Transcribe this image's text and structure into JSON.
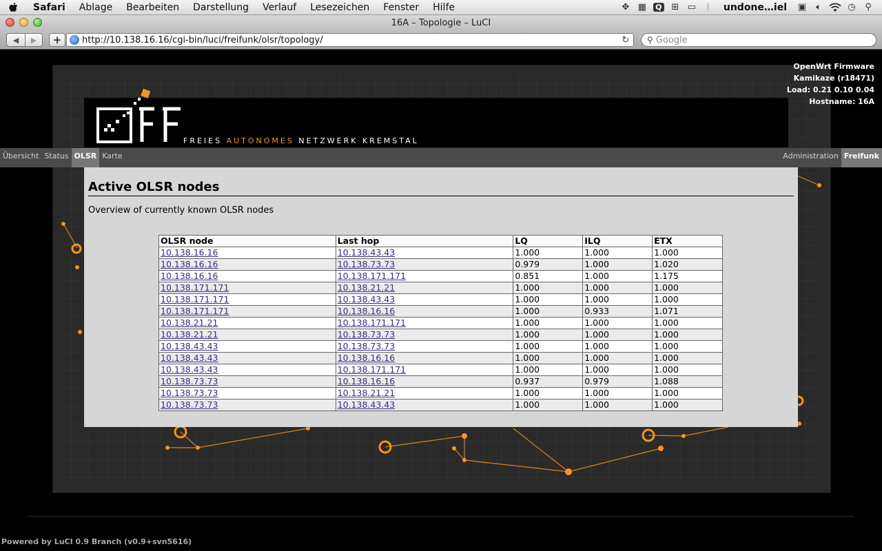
{
  "menubar": {
    "app": "Safari",
    "items": [
      "Ablage",
      "Bearbeiten",
      "Darstellung",
      "Verlauf",
      "Lesezeichen",
      "Fenster",
      "Hilfe"
    ],
    "user": "undone…iel"
  },
  "window": {
    "title": "16A – Topologie – LuCI"
  },
  "toolbar": {
    "url": "http://10.138.16.16/cgi-bin/luci/freifunk/olsr/topology/",
    "search_placeholder": "Google"
  },
  "header": {
    "tagline_1": "FREIES ",
    "tagline_2": "AUTONOMES",
    "tagline_3": " NETZWERK KREMSTAL",
    "sysinfo": [
      "OpenWrt Firmware",
      "Kamikaze (r18471)",
      "Load: 0.21 0.10 0.04",
      "Hostname: 16A"
    ]
  },
  "nav": {
    "left": [
      "Übersicht",
      "Status",
      "OLSR",
      "Karte"
    ],
    "right": [
      "Administration",
      "Freifunk"
    ]
  },
  "main": {
    "title": "Active OLSR nodes",
    "description": "Overview of currently known OLSR nodes",
    "columns": [
      "OLSR node",
      "Last hop",
      "LQ",
      "ILQ",
      "ETX"
    ],
    "rows": [
      [
        "10.138.16.16",
        "10.138.43.43",
        "1.000",
        "1.000",
        "1.000"
      ],
      [
        "10.138.16.16",
        "10.138.73.73",
        "0.979",
        "1.000",
        "1.020"
      ],
      [
        "10.138.16.16",
        "10.138.171.171",
        "0.851",
        "1.000",
        "1.175"
      ],
      [
        "10.138.171.171",
        "10.138.21.21",
        "1.000",
        "1.000",
        "1.000"
      ],
      [
        "10.138.171.171",
        "10.138.43.43",
        "1.000",
        "1.000",
        "1.000"
      ],
      [
        "10.138.171.171",
        "10.138.16.16",
        "1.000",
        "0.933",
        "1.071"
      ],
      [
        "10.138.21.21",
        "10.138.171.171",
        "1.000",
        "1.000",
        "1.000"
      ],
      [
        "10.138.21.21",
        "10.138.73.73",
        "1.000",
        "1.000",
        "1.000"
      ],
      [
        "10.138.43.43",
        "10.138.73.73",
        "1.000",
        "1.000",
        "1.000"
      ],
      [
        "10.138.43.43",
        "10.138.16.16",
        "1.000",
        "1.000",
        "1.000"
      ],
      [
        "10.138.43.43",
        "10.138.171.171",
        "1.000",
        "1.000",
        "1.000"
      ],
      [
        "10.138.73.73",
        "10.138.16.16",
        "0.937",
        "0.979",
        "1.088"
      ],
      [
        "10.138.73.73",
        "10.138.21.21",
        "1.000",
        "1.000",
        "1.000"
      ],
      [
        "10.138.73.73",
        "10.138.43.43",
        "1.000",
        "1.000",
        "1.000"
      ]
    ]
  },
  "footer": {
    "text": "Powered by LuCI 0.9 Branch (v0.9+svn5616)"
  },
  "colors": {
    "accent": "#f7931e",
    "link": "#3b2a8a",
    "nav_bg": "#4a4a4a",
    "content_bg": "#d6d6d6"
  }
}
